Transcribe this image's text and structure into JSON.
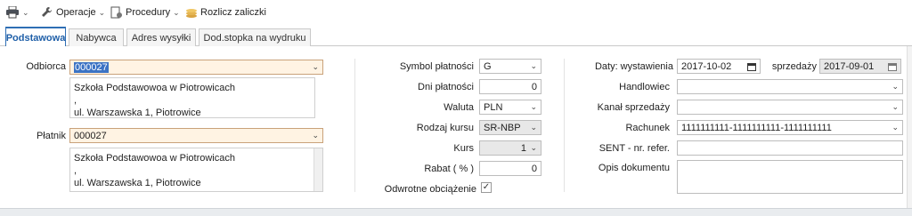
{
  "toolbar": {
    "print_icon": "printer-icon",
    "operacje": "Operacje",
    "procedury": "Procedury",
    "rozlicz": "Rozlicz zaliczki"
  },
  "tabs": [
    {
      "label": "Podstawowa",
      "active": true
    },
    {
      "label": "Nabywca",
      "active": false
    },
    {
      "label": "Adres wysyłki",
      "active": false
    },
    {
      "label": "Dod.stopka na wydruku",
      "active": false
    }
  ],
  "left": {
    "odbiorca_label": "Odbiorca",
    "odbiorca_value": "000027",
    "odbiorca_address": [
      "Szkoła Podstawowoa w Piotrowicach",
      ",",
      "ul. Warszawska 1, Piotrowice"
    ],
    "platnik_label": "Płatnik",
    "platnik_value": "000027",
    "platnik_address": [
      "Szkoła Podstawowoa w Piotrowicach",
      ",",
      "ul. Warszawska 1, Piotrowice"
    ]
  },
  "middle": {
    "symbol_label": "Symbol płatności",
    "symbol_value": "G",
    "dni_label": "Dni płatności",
    "dni_value": "0",
    "waluta_label": "Waluta",
    "waluta_value": "PLN",
    "rodzaj_label": "Rodzaj kursu",
    "rodzaj_value": "SR-NBP",
    "kurs_label": "Kurs",
    "kurs_value": "1",
    "rabat_label": "Rabat ( % )",
    "rabat_value": "0",
    "odwrotne_label": "Odwrotne obciążenie",
    "odwrotne_checked": true
  },
  "right": {
    "daty_label": "Daty: wystawienia",
    "wystawienia_value": "2017-10-02",
    "sprzedazy_label": "sprzedaży",
    "sprzedazy_value": "2017-09-01",
    "handlowiec_label": "Handlowiec",
    "handlowiec_value": "",
    "kanal_label": "Kanał sprzedaży",
    "kanal_value": "",
    "rachunek_label": "Rachunek",
    "rachunek_value": "1111111111-1111111111-1111111111",
    "sent_label": "SENT - nr. refer.",
    "sent_value": "",
    "opis_label": "Opis dokumentu",
    "opis_value": ""
  },
  "colors": {
    "accent": "#2f6fb5",
    "orange_field": "#fff3e3"
  }
}
